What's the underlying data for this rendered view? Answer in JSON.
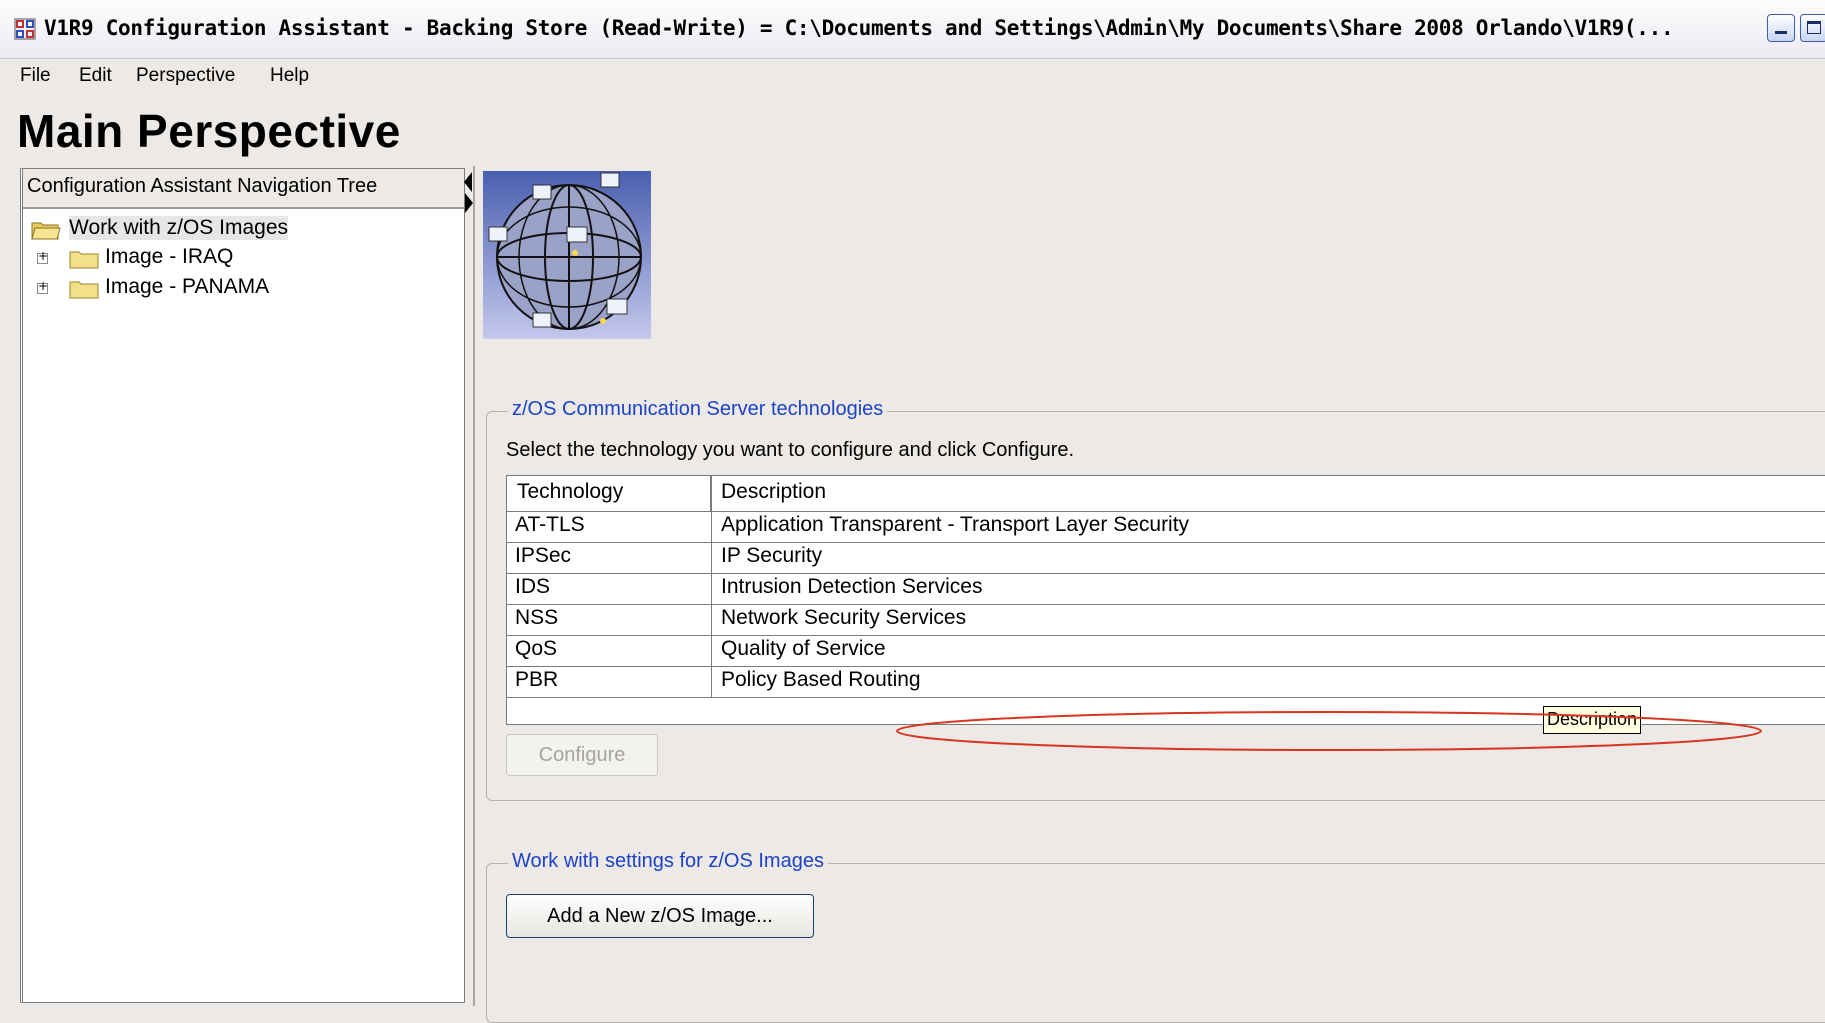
{
  "window": {
    "title": "V1R9 Configuration Assistant - Backing Store (Read-Write) = C:\\Documents and Settings\\Admin\\My Documents\\Share 2008 Orlando\\V1R9(...",
    "icon": "app-grid-icon"
  },
  "menubar": {
    "items": [
      "File",
      "Edit",
      "Perspective",
      "Help"
    ]
  },
  "page_title": "Main Perspective",
  "nav": {
    "header": "Configuration Assistant Navigation Tree",
    "root": "Work with z/OS Images",
    "children": [
      "Image - IRAQ",
      "Image - PANAMA"
    ]
  },
  "technologies": {
    "group_title": "z/OS Communication Server technologies",
    "instruction": "Select the  technology you want to configure and click Configure.",
    "columns": [
      "Technology",
      "Description"
    ],
    "rows": [
      {
        "tech": "AT-TLS",
        "desc": "Application Transparent - Transport Layer Security"
      },
      {
        "tech": "IPSec",
        "desc": "IP Security"
      },
      {
        "tech": "IDS",
        "desc": "Intrusion Detection Services"
      },
      {
        "tech": "NSS",
        "desc": "Network Security Services"
      },
      {
        "tech": "QoS",
        "desc": "Quality of Service"
      },
      {
        "tech": "PBR",
        "desc": "Policy Based Routing"
      }
    ],
    "tooltip": "Description",
    "configure_label": "Configure"
  },
  "images_group": {
    "group_title": "Work with settings for z/OS Images",
    "add_label": "Add a New z/OS Image..."
  },
  "colors": {
    "group_title": "#1d44c7",
    "annotation": "#d9351e"
  }
}
